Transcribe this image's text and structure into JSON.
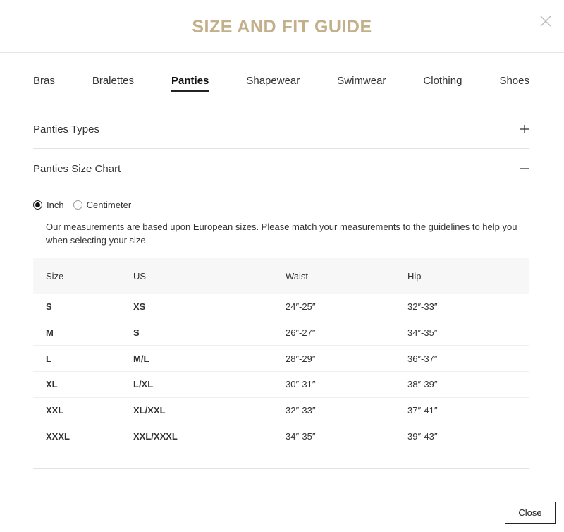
{
  "modal": {
    "title": "SIZE AND FIT GUIDE",
    "close_icon": "close-x-icon"
  },
  "tabs": [
    {
      "label": "Bras",
      "active": false
    },
    {
      "label": "Bralettes",
      "active": false
    },
    {
      "label": "Panties",
      "active": true
    },
    {
      "label": "Shapewear",
      "active": false
    },
    {
      "label": "Swimwear",
      "active": false
    },
    {
      "label": "Clothing",
      "active": false
    },
    {
      "label": "Shoes",
      "active": false
    }
  ],
  "sections": {
    "types": {
      "label": "Panties Types",
      "toggle_icon": "plus-icon",
      "expanded": false
    },
    "chart": {
      "label": "Panties Size Chart",
      "toggle_icon": "minus-icon",
      "expanded": true
    }
  },
  "units": {
    "options": [
      {
        "label": "Inch",
        "selected": true
      },
      {
        "label": "Centimeter",
        "selected": false
      }
    ]
  },
  "note": "Our measurements are based upon European sizes. Please match your measurements to the guidelines to help you when selecting your size.",
  "table": {
    "headers": [
      "Size",
      "US",
      "Waist",
      "Hip"
    ],
    "rows": [
      [
        "S",
        "XS",
        "24″-25″",
        "32″-33″"
      ],
      [
        "M",
        "S",
        "26″-27″",
        "34″-35″"
      ],
      [
        "L",
        "M/L",
        "28″-29″",
        "36″-37″"
      ],
      [
        "XL",
        "L/XL",
        "30″-31″",
        "38″-39″"
      ],
      [
        "XXL",
        "XL/XXL",
        "32″-33″",
        "37″-41″"
      ],
      [
        "XXXL",
        "XXL/XXXL",
        "34″-35″",
        "39″-43″"
      ]
    ]
  },
  "footer": {
    "close_label": "Close"
  },
  "colors": {
    "title_gold": "#c2b08a",
    "text": "#333333",
    "divider": "#e3e3e3",
    "table_header_bg": "#f7f7f7"
  }
}
